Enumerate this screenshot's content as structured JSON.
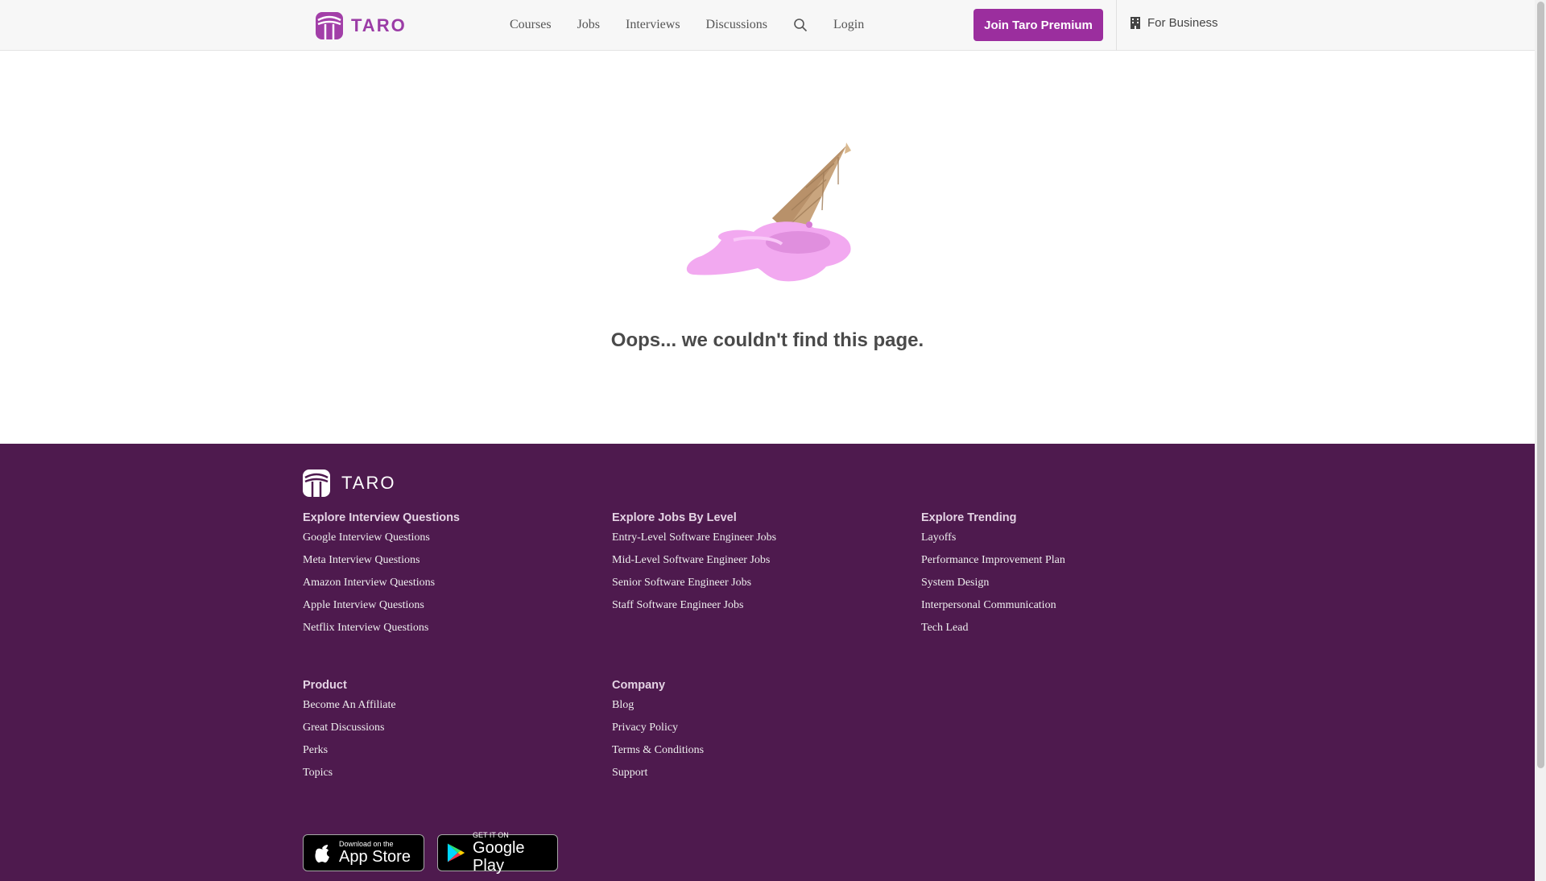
{
  "brand": {
    "name": "TARO",
    "accent": "#9b2e9e",
    "footer_bg": "#4e1a4e"
  },
  "header": {
    "nav": [
      "Courses",
      "Jobs",
      "Interviews",
      "Discussions"
    ],
    "search_icon": "search-icon",
    "login": "Login",
    "premium_button": "Join Taro Premium",
    "for_business": "For Business"
  },
  "main": {
    "illustration": "melted-ice-cream-cone",
    "message": "Oops... we couldn't find this page."
  },
  "footer": {
    "columns_top": [
      {
        "title": "Explore Interview Questions",
        "links": [
          "Google Interview Questions",
          "Meta Interview Questions",
          "Amazon Interview Questions",
          "Apple Interview Questions",
          "Netflix Interview Questions"
        ]
      },
      {
        "title": "Explore Jobs By Level",
        "links": [
          "Entry-Level Software Engineer Jobs",
          "Mid-Level Software Engineer Jobs",
          "Senior Software Engineer Jobs",
          "Staff Software Engineer Jobs"
        ]
      },
      {
        "title": "Explore Trending",
        "links": [
          "Layoffs",
          "Performance Improvement Plan",
          "System Design",
          "Interpersonal Communication",
          "Tech Lead"
        ]
      }
    ],
    "columns_bottom": [
      {
        "title": "Product",
        "links": [
          "Become An Affiliate",
          "Great Discussions",
          "Perks",
          "Topics"
        ]
      },
      {
        "title": "Company",
        "links": [
          "Blog",
          "Privacy Policy",
          "Terms & Conditions",
          "Support"
        ]
      }
    ],
    "app_store": {
      "small": "Download on the",
      "big": "App Store"
    },
    "google_play": {
      "small": "GET IT ON",
      "big": "Google Play"
    }
  }
}
